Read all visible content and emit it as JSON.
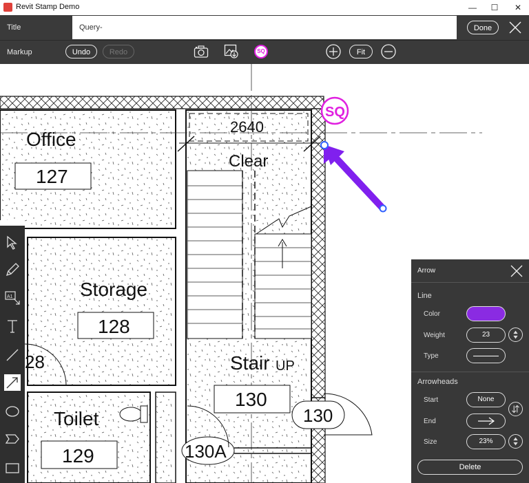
{
  "window": {
    "title": "Revit Stamp Demo",
    "minimize": "—",
    "maximize": "☐",
    "close": "✕"
  },
  "header": {
    "title_label": "Title",
    "title_value": "Query-",
    "done_label": "Done",
    "close_icon": "close-icon"
  },
  "markup_bar": {
    "label": "Markup",
    "undo_label": "Undo",
    "redo_label": "Redo",
    "stamp_label": "SQ",
    "fit_label": "Fit",
    "icons": [
      "camera-icon",
      "image-export-icon",
      "stamp-icon",
      "zoom-in-icon",
      "zoom-out-icon"
    ]
  },
  "drawing": {
    "rooms": [
      {
        "name": "Office",
        "number": "127"
      },
      {
        "name": "Storage",
        "number": "128"
      },
      {
        "name": "Toilet",
        "number": "129"
      },
      {
        "name": "Stair",
        "number": "130"
      }
    ],
    "dimension": "2640",
    "clear_label": "Clear",
    "up_label": "UP",
    "tag_130": "130",
    "tag_130a": "130A",
    "tag_28": "28",
    "stamp": "SQ",
    "accent_color": "#e020e0",
    "arrow_color": "#8020ee"
  },
  "tools": [
    "select-icon",
    "pencil-icon",
    "text-box-icon",
    "text-icon",
    "line-icon",
    "arrow-icon",
    "ellipse-icon",
    "polygon-icon",
    "rectangle-icon"
  ],
  "arrow_panel": {
    "title": "Arrow",
    "line_section": "Line",
    "color_label": "Color",
    "color_value": "#8a2be2",
    "weight_label": "Weight",
    "weight_value": "23",
    "type_label": "Type",
    "arrowheads_section": "Arrowheads",
    "start_label": "Start",
    "start_value": "None",
    "end_label": "End",
    "size_label": "Size",
    "size_value": "23%",
    "delete_label": "Delete"
  }
}
